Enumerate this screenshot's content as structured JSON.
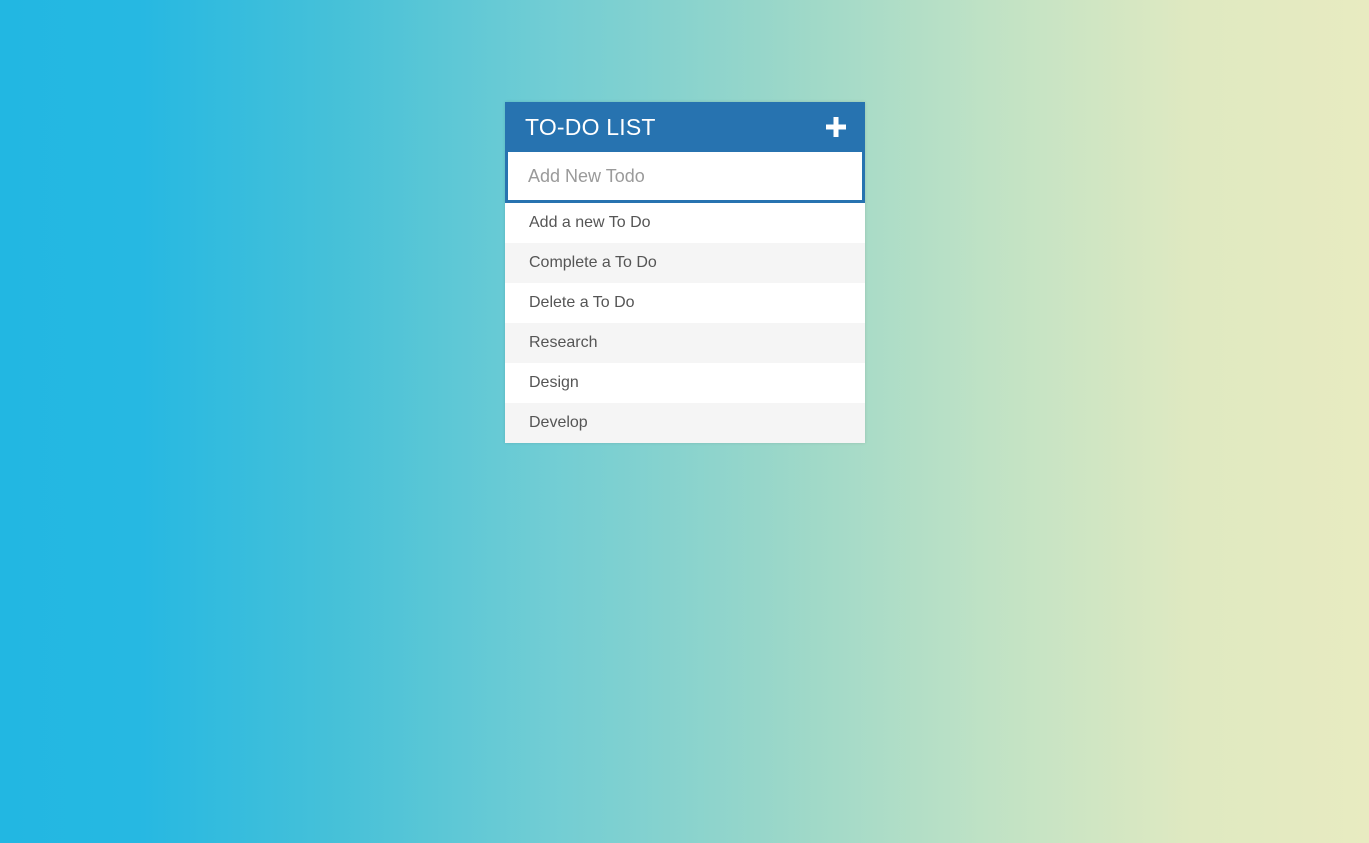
{
  "app": {
    "title": "TO-DO LIST",
    "add_icon": "plus-icon",
    "header_color": "#2773b0"
  },
  "input": {
    "placeholder": "Add New Todo",
    "value": ""
  },
  "todos": [
    {
      "label": "Add a new To Do"
    },
    {
      "label": "Complete a To Do"
    },
    {
      "label": "Delete a To Do"
    },
    {
      "label": "Research"
    },
    {
      "label": "Design"
    },
    {
      "label": "Develop"
    }
  ]
}
